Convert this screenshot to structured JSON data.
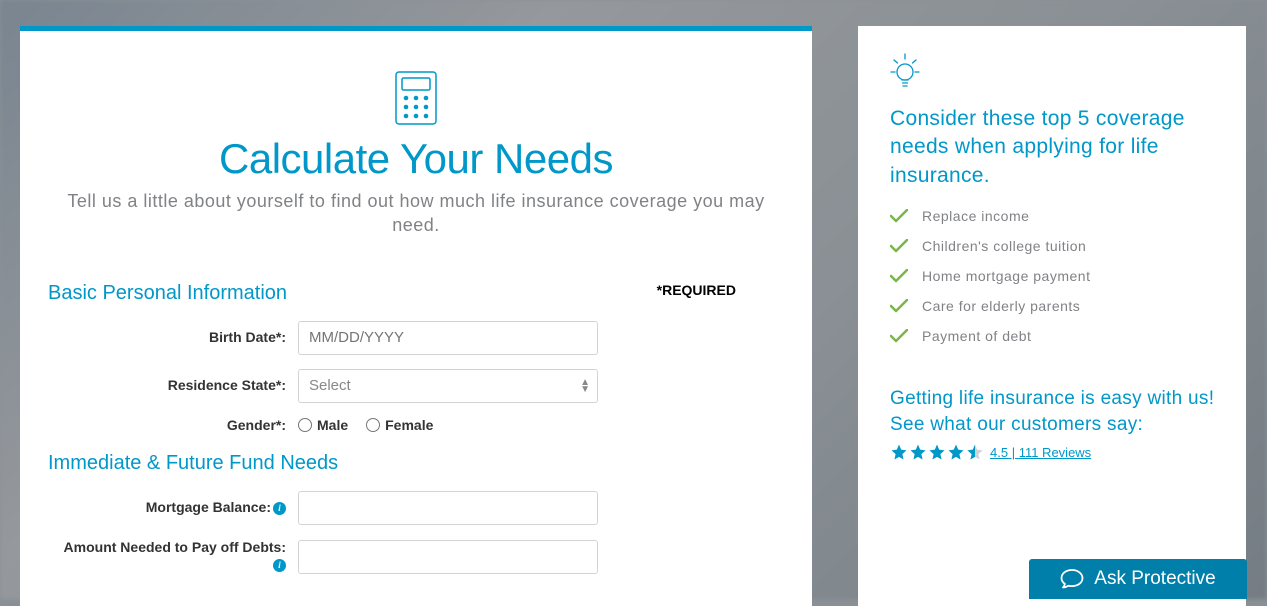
{
  "main": {
    "title": "Calculate Your Needs",
    "subtitle": "Tell us a little about yourself to find out how much life insurance coverage you may need.",
    "required_label": "*REQUIRED",
    "sections": {
      "basic": {
        "title": "Basic Personal Information",
        "birth_date_label": "Birth Date*:",
        "birth_date_placeholder": "MM/DD/YYYY",
        "state_label": "Residence State*:",
        "state_placeholder": "Select",
        "gender_label": "Gender*:",
        "gender_male": "Male",
        "gender_female": "Female"
      },
      "funds": {
        "title": "Immediate & Future Fund Needs",
        "mortgage_label": "Mortgage Balance:",
        "debts_label": "Amount Needed to Pay off Debts:"
      }
    }
  },
  "sidebar": {
    "title": "Consider these top 5 coverage needs when applying for life insurance.",
    "items": [
      "Replace income",
      "Children's college tuition",
      "Home mortgage payment",
      "Care for elderly parents",
      "Payment of debt"
    ],
    "reviews_heading": "Getting life insurance is easy with us! See what our customers say:",
    "rating_value": "4.5",
    "rating_sep": " | ",
    "rating_count": "111 Reviews"
  },
  "ask_button": "Ask Protective"
}
